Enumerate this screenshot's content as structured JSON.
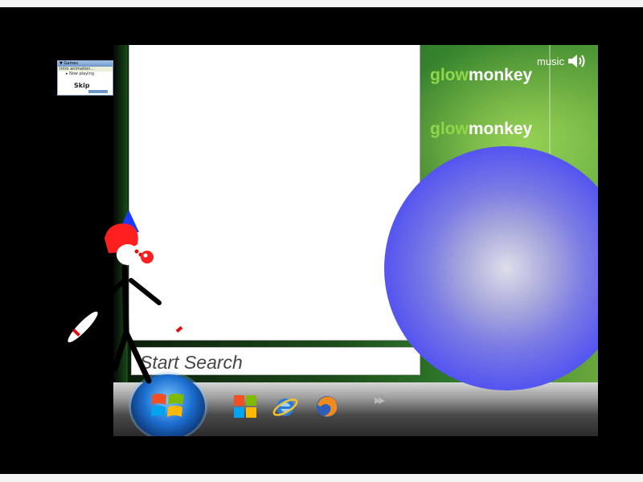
{
  "brand": {
    "glow": "glow",
    "monkey": "monkey"
  },
  "music": {
    "label": "music",
    "icon": "speaker-icon"
  },
  "search": {
    "placeholder": "Start Search"
  },
  "mini_window": {
    "header": "▼ Games",
    "title": "Intro animation...",
    "now_playing": "▸ Now playing",
    "skip": "Skip"
  },
  "taskbar": {
    "icons": [
      "windows-orb-icon",
      "windows-flag-icon",
      "internet-explorer-icon",
      "firefox-icon"
    ]
  },
  "colors": {
    "glow_accent": "#8fd84a",
    "ball": "#4747f2",
    "clown_hair": "#ff1f1f",
    "clown_hat": "#1a3cff"
  }
}
